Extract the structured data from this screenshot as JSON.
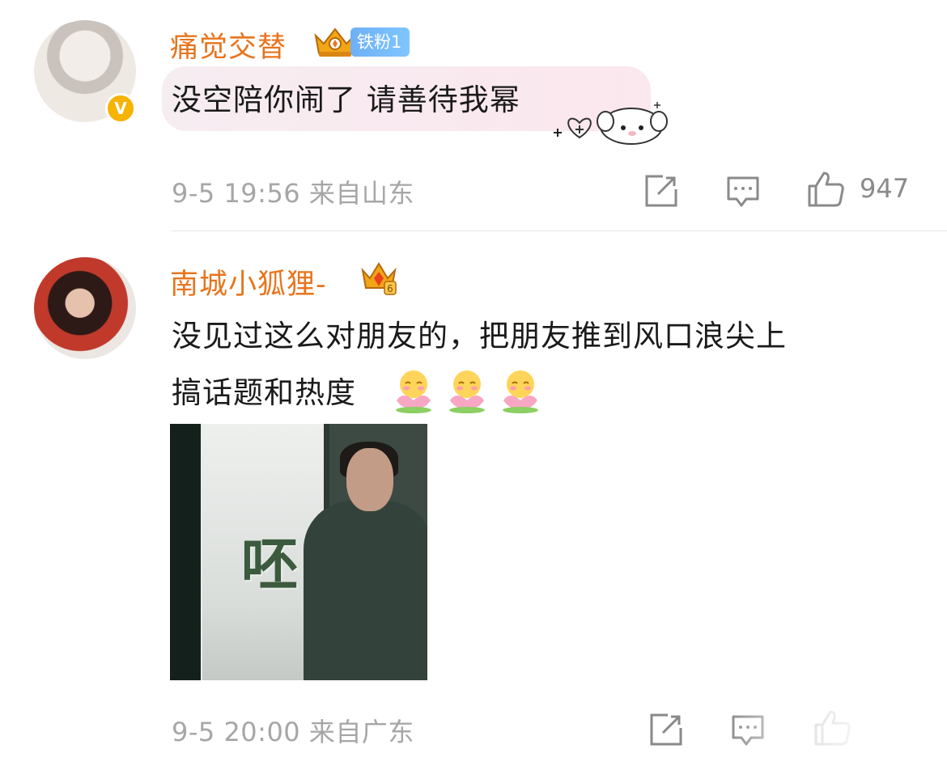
{
  "comments": [
    {
      "username": "痛觉交替",
      "fan_badge": "铁粉1",
      "verified_mark": "V",
      "text": "没空陪你闹了 请善待我幂",
      "time": "9-5 19:56",
      "location": "来自山东",
      "like_count": "947",
      "icons": [
        "avatar",
        "verified-icon",
        "crown-icon",
        "share-icon",
        "comment-icon",
        "like-icon",
        "sticker-icon"
      ]
    },
    {
      "username": "南城小狐狸-",
      "text_line1": "没见过这么对朋友的，把朋友推到风口浪尖上",
      "text_line2": "搞话题和热度",
      "emoji_count_label": "",
      "photo_caption": "呸",
      "time": "9-5 20:00",
      "location": "来自广东",
      "icons": [
        "avatar",
        "crown-icon",
        "flower-emoji",
        "share-icon",
        "comment-icon",
        "like-icon"
      ]
    }
  ],
  "colors": {
    "username": "#e8741c",
    "meta": "#a6a6a6",
    "fan_badge": "#6fb0f5",
    "verified": "#f6b300",
    "bubble": "#fbe7ee"
  }
}
